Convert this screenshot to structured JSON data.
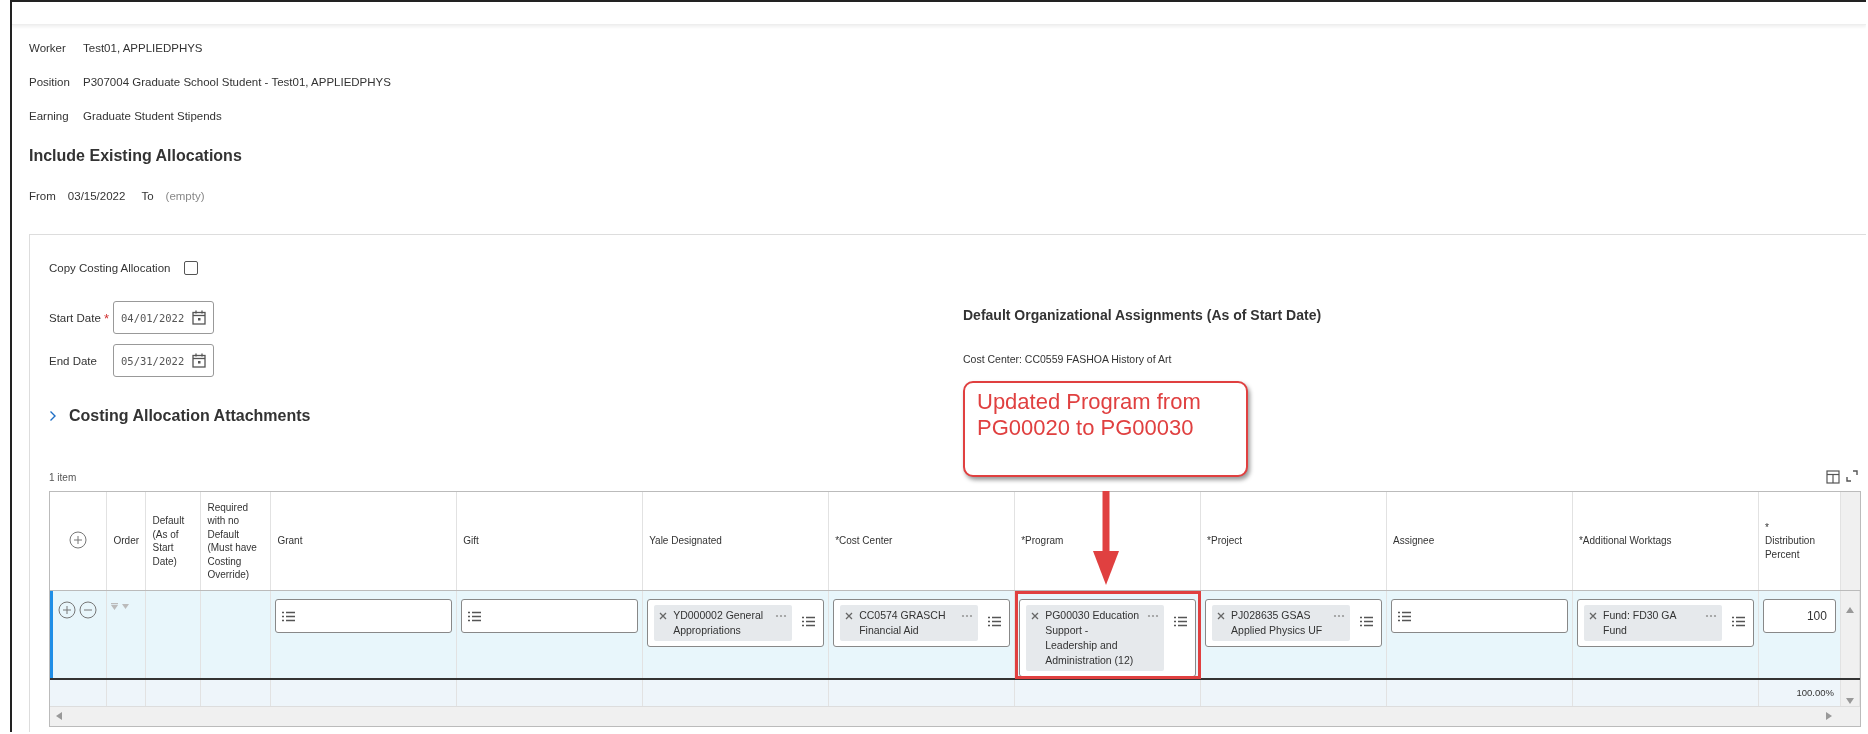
{
  "header_fields": [
    {
      "label": "Worker",
      "value": "Test01, APPLIEDPHYS"
    },
    {
      "label": "Position",
      "value": "P307004 Graduate School Student - Test01, APPLIEDPHYS"
    },
    {
      "label": "Earning",
      "value": "Graduate Student Stipends"
    }
  ],
  "existing": {
    "title": "Include Existing Allocations",
    "from_label": "From",
    "from_value": "03/15/2022",
    "to_label": "To",
    "to_value": "(empty)"
  },
  "form": {
    "copy_costing": {
      "label": "Copy Costing Allocation",
      "checked": false
    },
    "required_mark": "*",
    "start_date": {
      "label": "Start Date",
      "required": true,
      "value": "04/01/2022"
    },
    "end_date": {
      "label": "End Date",
      "required": false,
      "value": "05/31/2022"
    },
    "attachments": {
      "label": "Costing Allocation Attachments",
      "expanded": false
    }
  },
  "default_org": {
    "title": "Default Organizational Assignments (As of Start Date)",
    "cost_center": "Cost Center: CC0559 FASHOA History of Art"
  },
  "callout": {
    "text": "Updated Program from PG00020 to PG00030"
  },
  "table": {
    "count": "1 item",
    "columns": [
      "",
      "Order",
      "Default (As of Start Date)",
      "Required with no Default (Must have Costing Override)",
      "Grant",
      "Gift",
      "Yale Designated",
      "*Cost Center",
      "*Program",
      "*Project",
      "Assignee",
      "*Additional Worktags",
      "*\nDistribution Percent"
    ],
    "rows": [
      {
        "selected": true,
        "cells": [
          {
            "kind": "row_actions"
          },
          {
            "kind": "order"
          },
          {
            "kind": "empty"
          },
          {
            "kind": "empty"
          },
          {
            "kind": "input"
          },
          {
            "kind": "input"
          },
          {
            "kind": "tag",
            "value": "YD000002 General Appropriations",
            "highlighted": false
          },
          {
            "kind": "tag",
            "value": "CC0574 GRASCH Financial Aid",
            "highlighted": false
          },
          {
            "kind": "tag",
            "value": "PG00030 Education Support - Leadership and Administration (12)",
            "highlighted": true
          },
          {
            "kind": "tag",
            "value": "PJ028635 GSAS Applied Physics UF",
            "highlighted": false
          },
          {
            "kind": "input"
          },
          {
            "kind": "tag",
            "value": "Fund: FD30 GA Fund",
            "highlighted": false
          },
          {
            "kind": "number",
            "value": "100"
          }
        ]
      }
    ],
    "total": "100.00%"
  }
}
